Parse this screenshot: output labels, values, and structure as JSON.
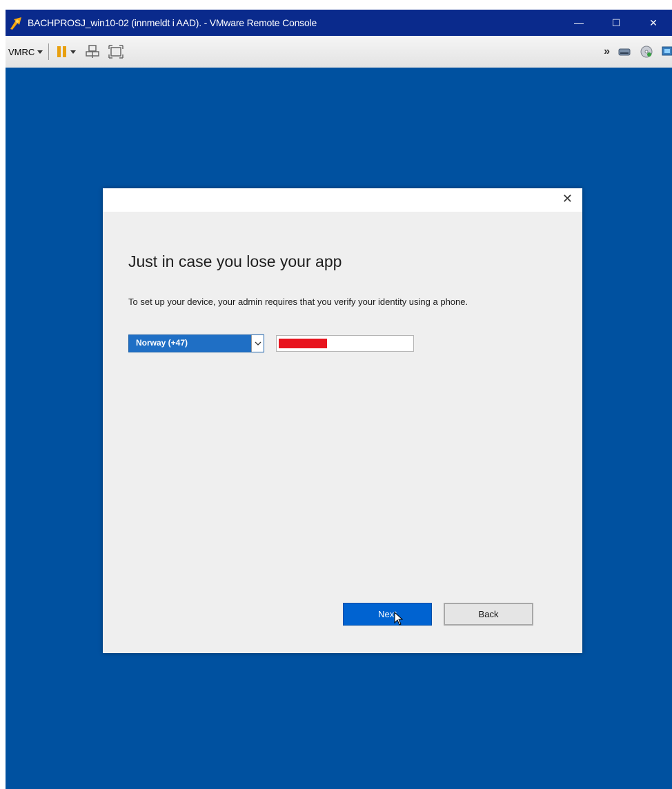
{
  "window": {
    "title": "BACHPROSJ_win10-02 (innmeldt i AAD). - VMware Remote Console",
    "minimize_glyph": "—",
    "maximize_glyph": "☐",
    "close_glyph": "✕"
  },
  "toolbar": {
    "menu_label": "VMRC",
    "icons": [
      "vmrc-dropdown-icon",
      "pause-icon",
      "send-ctrl-alt-del-icon",
      "fullscreen-icon",
      "more-chevron-icon",
      "removable-device-icon",
      "cd-dvd-icon",
      "network-icon"
    ],
    "more_glyph": "»"
  },
  "dialog": {
    "close_glyph": "✕",
    "heading": "Just in case you lose your app",
    "description": "To set up your device, your admin requires that you verify your identity using a phone.",
    "country_select": {
      "selected": "Norway (+47)"
    },
    "phone_input": {
      "value_redacted": true
    },
    "next_label": "Next",
    "back_label": "Back"
  },
  "colors": {
    "titlebar": "#0a2a8c",
    "desktop": "#0051a0",
    "dialog_bg": "#efefef",
    "primary_button": "#0063d1",
    "select_highlight": "#1f6fc5",
    "redaction": "#e8141e"
  }
}
